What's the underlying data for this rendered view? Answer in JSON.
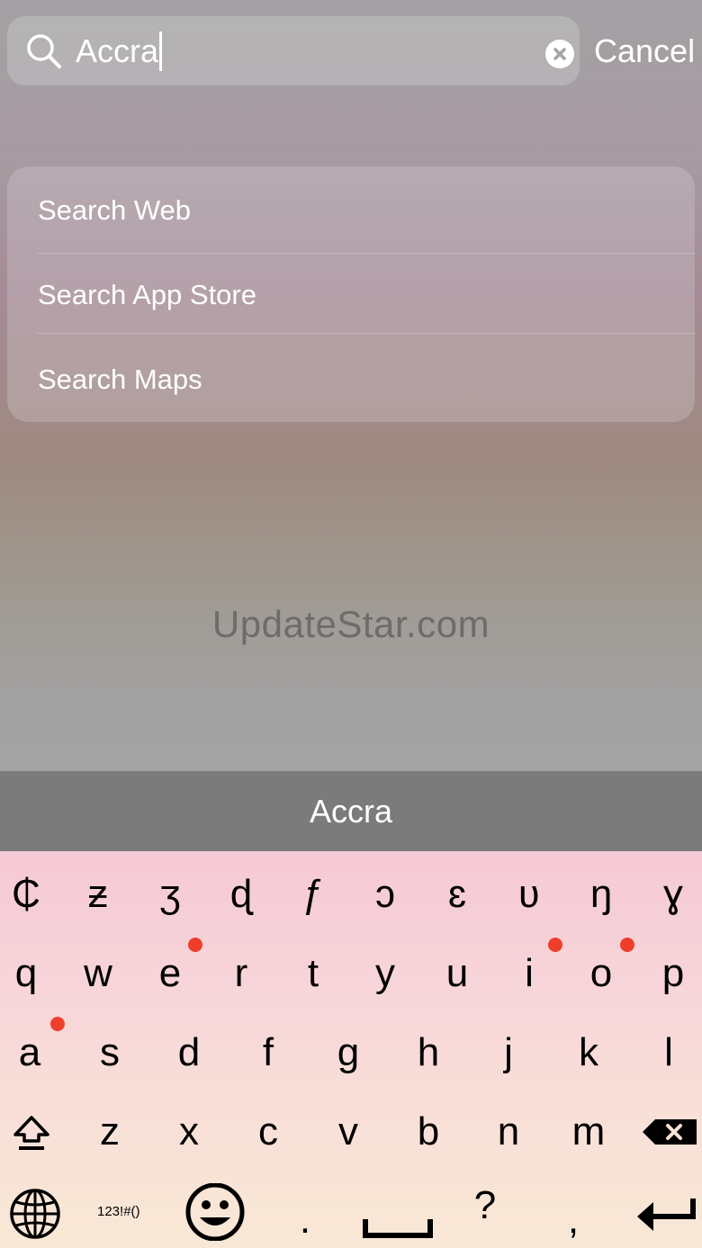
{
  "search": {
    "query": "Accra",
    "cancel_label": "Cancel"
  },
  "suggestions": [
    {
      "label": "Search Web"
    },
    {
      "label": "Search App Store"
    },
    {
      "label": "Search Maps"
    }
  ],
  "watermark": "UpdateStar.com",
  "keyboard": {
    "prediction": "Accra",
    "row_special": [
      "₵",
      "ƶ",
      "ʒ",
      "ɖ",
      "ƒ",
      "ɔ",
      "ɛ",
      "ʋ",
      "ŋ",
      "ɣ"
    ],
    "row1": [
      "q",
      "w",
      "e",
      "r",
      "t",
      "y",
      "u",
      "i",
      "o",
      "p"
    ],
    "row2": [
      "a",
      "s",
      "d",
      "f",
      "g",
      "h",
      "j",
      "k",
      "l"
    ],
    "row3": [
      "z",
      "x",
      "c",
      "v",
      "b",
      "n",
      "m"
    ],
    "numbers_label": "123!#()",
    "period": ".",
    "question": "?",
    "comma": ",",
    "accent_dot_color": "#ef3e2c",
    "icons": [
      "shift-icon",
      "backspace-icon",
      "globe-icon",
      "emoji-icon",
      "space-icon",
      "return-icon"
    ]
  }
}
